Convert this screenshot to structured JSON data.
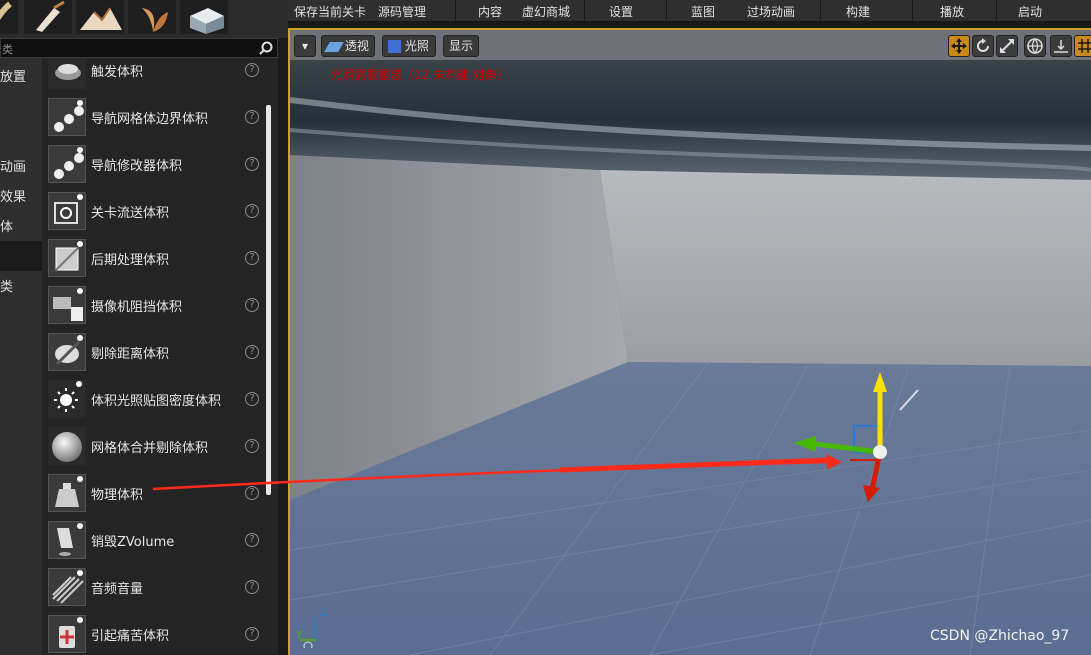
{
  "toolbar": {
    "items": [
      "保存当前关卡",
      "源码管理",
      "内容",
      "虚幻商城",
      "设置",
      "蓝图",
      "过场动画",
      "构建",
      "播放",
      "启动"
    ]
  },
  "mode_bar": {
    "thumbs": [
      "place-mode-icon",
      "paint-mode-icon",
      "landscape-mode-icon",
      "foliage-mode-icon",
      "geometry-mode-icon"
    ]
  },
  "search": {
    "placeholder": "类"
  },
  "categories": {
    "items": [
      {
        "label": "放置",
        "selected": false
      },
      {
        "label": "动画",
        "selected": false
      },
      {
        "label": "效果",
        "selected": false
      },
      {
        "label": "体",
        "selected": false
      },
      {
        "label": "",
        "selected": true
      },
      {
        "label": "类",
        "selected": false
      }
    ]
  },
  "volume_list": {
    "items": [
      {
        "label": "触发体积",
        "icon": "trigger-volume-icon"
      },
      {
        "label": "导航网格体边界体积",
        "icon": "nav-mesh-bounds-icon"
      },
      {
        "label": "导航修改器体积",
        "icon": "nav-modifier-icon"
      },
      {
        "label": "关卡流送体积",
        "icon": "level-streaming-icon"
      },
      {
        "label": "后期处理体积",
        "icon": "post-process-icon"
      },
      {
        "label": "摄像机阻挡体积",
        "icon": "camera-blocking-icon"
      },
      {
        "label": "剔除距离体积",
        "icon": "cull-distance-icon"
      },
      {
        "label": "体积光照贴图密度体积",
        "icon": "lightmap-density-icon"
      },
      {
        "label": "网格体合并剔除体积",
        "icon": "mesh-merge-cull-icon"
      },
      {
        "label": "物理体积",
        "icon": "physics-volume-icon"
      },
      {
        "label": "销毁ZVolume",
        "icon": "kill-z-volume-icon"
      },
      {
        "label": "音频音量",
        "icon": "audio-volume-icon"
      },
      {
        "label": "引起痛苦体积",
        "icon": "pain-causing-icon"
      }
    ],
    "help_glyph": "?"
  },
  "viewport": {
    "view_dropdown_glyph": "▾",
    "perspective_label": "透视",
    "lit_label": "光照",
    "show_label": "显示",
    "lighting_warning": "光照需要重建（12 未构建 对象）",
    "axis_z": "Z",
    "axis_y": "Y",
    "tools": [
      "translate-icon",
      "rotate-icon",
      "scale-icon",
      "world-local-icon",
      "surface-snap-icon",
      "grid-snap-icon"
    ]
  },
  "watermark": "CSDN @Zhichao_97",
  "colors": {
    "accent": "#c9a227",
    "warning": "#d40000",
    "annotation_arrow": "#ff2a1a"
  }
}
